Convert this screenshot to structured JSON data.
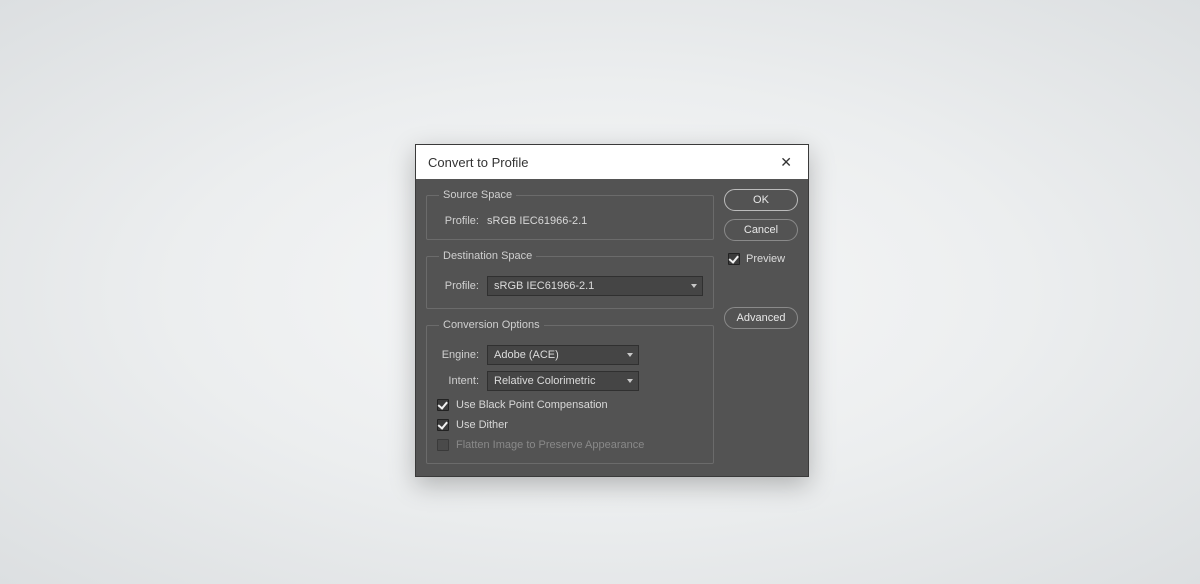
{
  "dialog": {
    "title": "Convert to Profile",
    "buttons": {
      "ok": "OK",
      "cancel": "Cancel",
      "advanced": "Advanced"
    },
    "preview_label": "Preview"
  },
  "source_space": {
    "legend": "Source Space",
    "profile_label": "Profile:",
    "profile_value": "sRGB IEC61966-2.1"
  },
  "destination_space": {
    "legend": "Destination Space",
    "profile_label": "Profile:",
    "profile_value": "sRGB IEC61966-2.1"
  },
  "conversion_options": {
    "legend": "Conversion Options",
    "engine_label": "Engine:",
    "engine_value": "Adobe (ACE)",
    "intent_label": "Intent:",
    "intent_value": "Relative Colorimetric",
    "bpc_label": "Use Black Point Compensation",
    "dither_label": "Use Dither",
    "flatten_label": "Flatten Image to Preserve Appearance"
  }
}
